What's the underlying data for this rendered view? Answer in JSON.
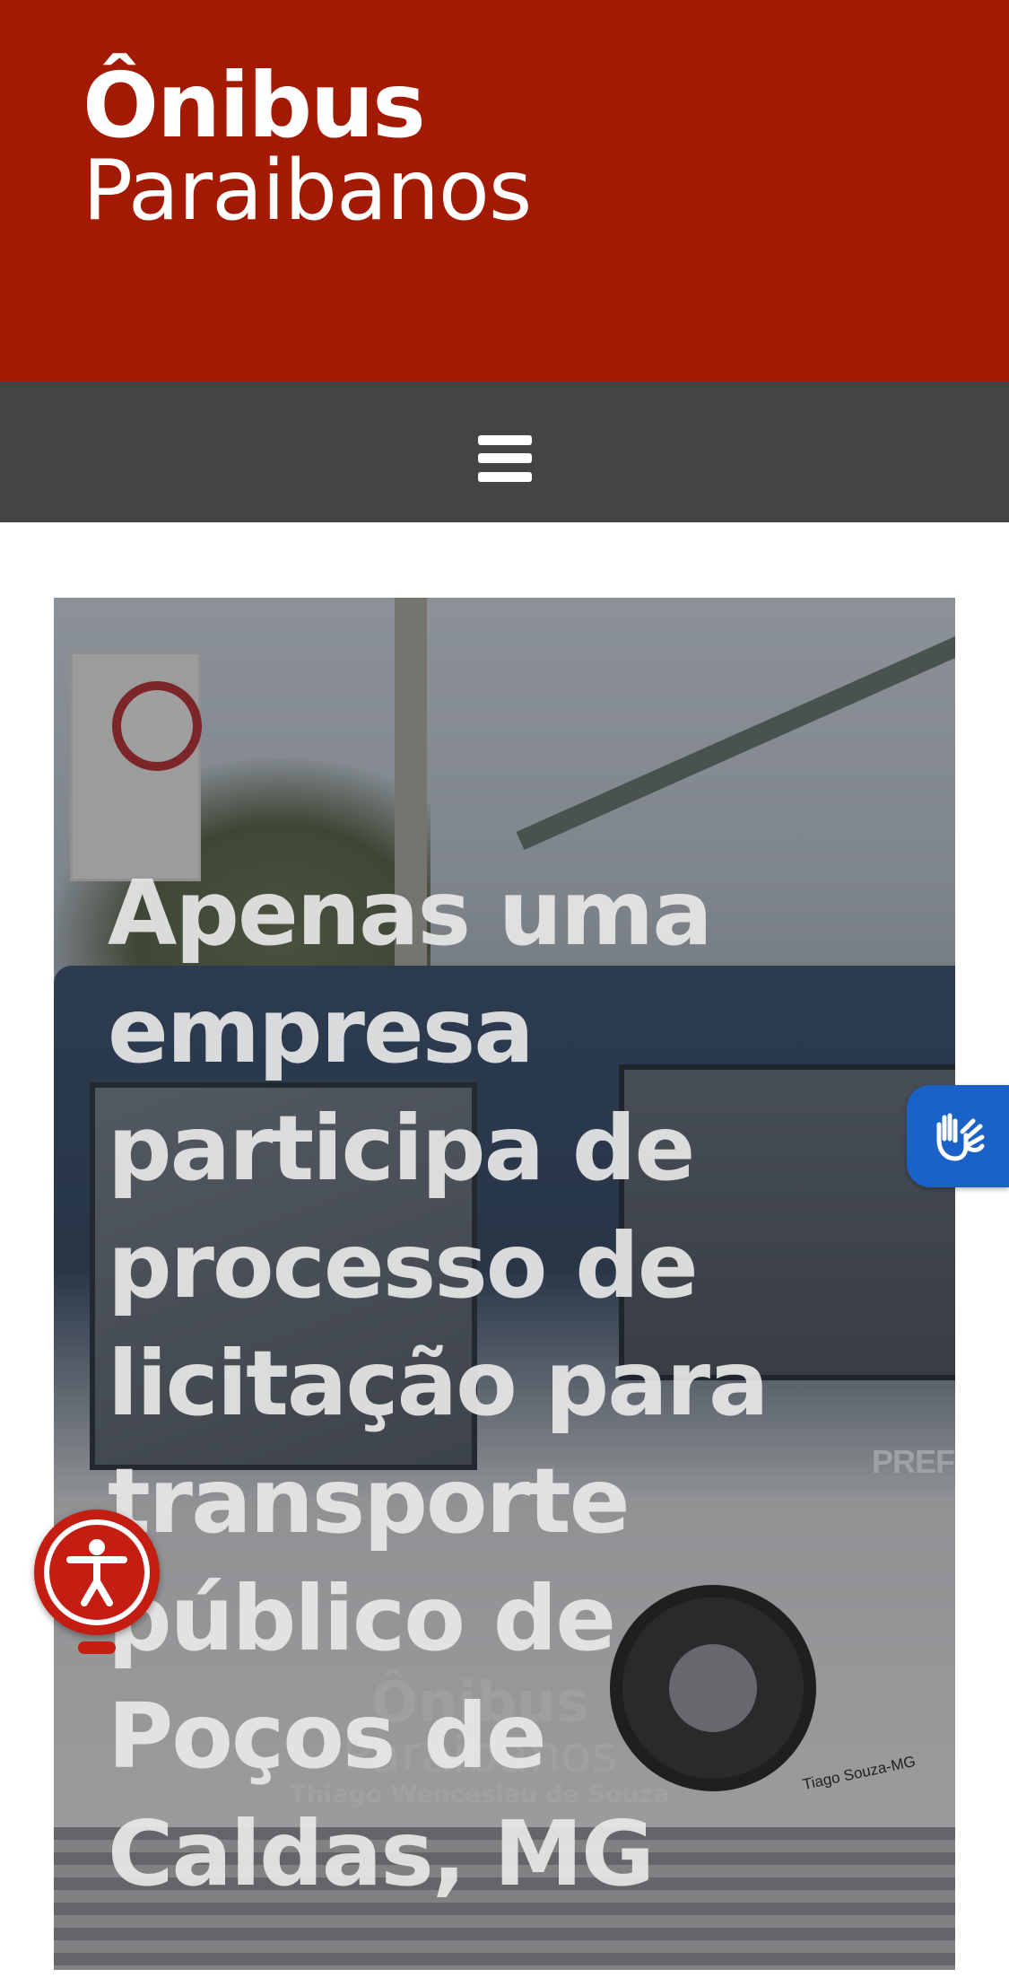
{
  "brand": {
    "line1": "Ônibus",
    "line2": "Paraibanos",
    "header_color": "#a31a03"
  },
  "nav": {
    "menu_icon": "hamburger-menu-icon",
    "bar_color": "#444444"
  },
  "article": {
    "title": "Apenas uma empresa participa de processo de licitação para transporte público de Poços de Caldas, MG",
    "image": {
      "description": "City bus at a bus stop",
      "bus_text": "PREFEITURA DE",
      "watermark": {
        "line1": "Ônibus",
        "line2": "Paraibanos",
        "line3": "Thiago Wenceslau de Souza"
      },
      "photo_credit": "Tiago Souza-MG"
    }
  },
  "floating": {
    "libras_icon": "sign-language-hands-icon",
    "libras_color": "#1a62c7",
    "accessibility_icon": "accessibility-person-icon",
    "accessibility_color": "#c41d12"
  }
}
